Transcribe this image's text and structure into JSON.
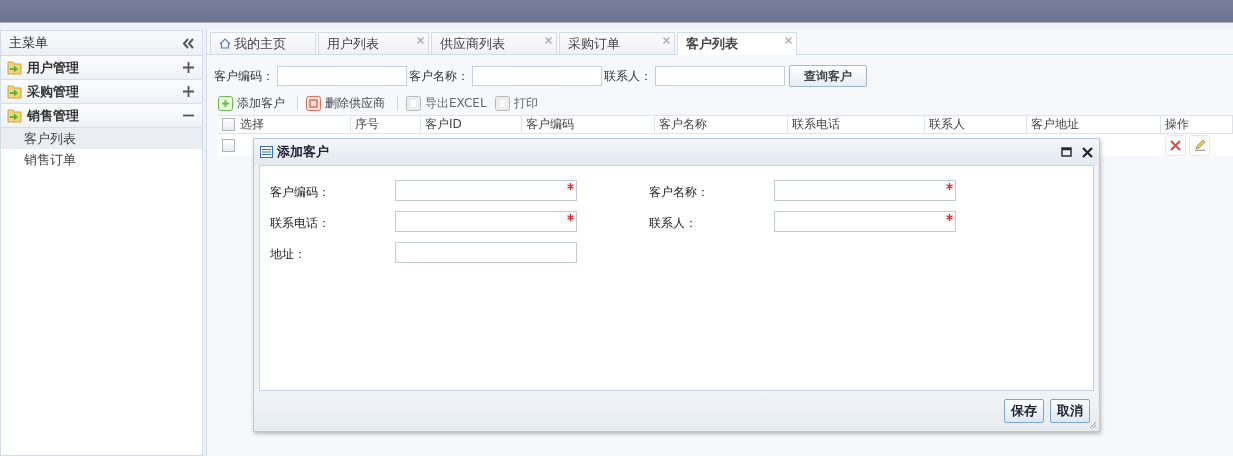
{
  "sidebar": {
    "title": "主菜单",
    "groups": [
      {
        "label": "用户管理",
        "expanded": false
      },
      {
        "label": "采购管理",
        "expanded": false
      },
      {
        "label": "销售管理",
        "expanded": true,
        "children": [
          {
            "label": "客户列表",
            "selected": true
          },
          {
            "label": "销售订单",
            "selected": false
          }
        ]
      }
    ]
  },
  "tabs": [
    {
      "label": "我的主页",
      "kind": "home",
      "selected": false
    },
    {
      "label": "用户列表",
      "kind": "closable",
      "selected": false
    },
    {
      "label": "供应商列表",
      "kind": "closable",
      "selected": false
    },
    {
      "label": "采购订单",
      "kind": "closable",
      "selected": false
    },
    {
      "label": "客户列表",
      "kind": "closable",
      "selected": true
    }
  ],
  "search": {
    "fields": [
      {
        "label": "客户编码："
      },
      {
        "label": "客户名称："
      },
      {
        "label": "联系人："
      }
    ],
    "button": "查询客户"
  },
  "toolbar": [
    {
      "label": "添加客户",
      "kind": "add"
    },
    {
      "label": "删除供应商",
      "kind": "delete"
    },
    {
      "label": "导出EXCEL",
      "kind": "plain"
    },
    {
      "label": "打印",
      "kind": "plain"
    }
  ],
  "table": {
    "header_checked": false,
    "columns": [
      "选择",
      "序号",
      "客户ID",
      "客户编码",
      "客户名称",
      "联系电话",
      "联系人",
      "客户地址",
      "操作"
    ],
    "rows": [
      {
        "checked": false
      }
    ]
  },
  "dialog": {
    "title": "添加客户",
    "fields": [
      {
        "label": "客户编码：",
        "required": true
      },
      {
        "label": "客户名称：",
        "required": true
      },
      {
        "label": "联系电话：",
        "required": true
      },
      {
        "label": "联系人：",
        "required": true
      },
      {
        "label": "地址：",
        "required": false
      }
    ],
    "buttons": [
      "保存",
      "取消"
    ]
  }
}
